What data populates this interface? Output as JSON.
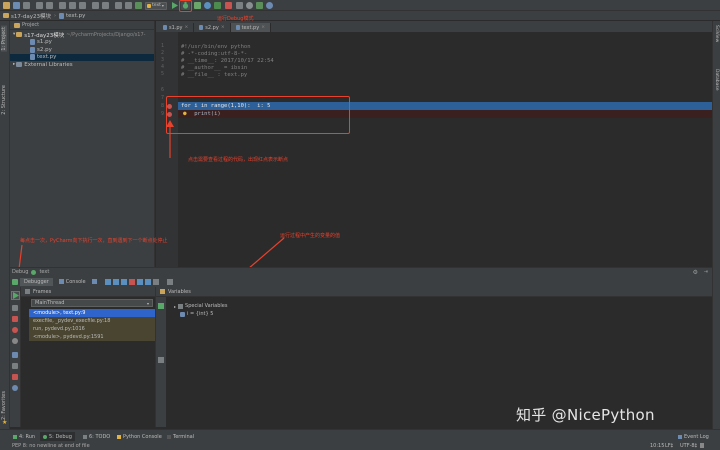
{
  "toolbar": {
    "run_config": "text"
  },
  "navbar": {
    "project": "s17-day23模块",
    "file": "text.py"
  },
  "left_tabs": {
    "project": "1: Project",
    "structure": "2: Structure",
    "favorites": "2: Favorites"
  },
  "right_tabs": {
    "sciview": "SciView",
    "database": "Database"
  },
  "project_panel": {
    "header": "Project",
    "tree": [
      {
        "label": "s17-day23模块",
        "sub": "~/PycharmProjects/Django/s17-"
      },
      {
        "label": "s1.py"
      },
      {
        "label": "s2.py"
      },
      {
        "label": "text.py"
      },
      {
        "label": "External Libraries"
      }
    ]
  },
  "editor": {
    "tabs": [
      "s1.py",
      "s2.py",
      "text.py"
    ],
    "lines": [
      {
        "n": "1",
        "text": "#!/usr/bin/env python"
      },
      {
        "n": "2",
        "text": "# -*-coding:utf-8-*-"
      },
      {
        "n": "3",
        "text": "# __time__: 2017/10/17 22:54"
      },
      {
        "n": "4",
        "text": "# __author__ = ibsin"
      },
      {
        "n": "5",
        "text": "# __file__ : text.py"
      },
      {
        "n": "6",
        "text": ""
      },
      {
        "n": "7",
        "text": ""
      },
      {
        "n": "8",
        "text": "for i in range(1,10):  i: 5"
      },
      {
        "n": "9",
        "text": "    print(i)"
      }
    ]
  },
  "annotations": {
    "debug_mode": "运行Debug模式",
    "breakpoint_tip": "点击需要查看过程的代码，出现红点表示断点",
    "step_tip": "每点击一次，PyCharm向下执行一次，直到遇到下一个断点处停止",
    "vars_tip": "运行过程中产生的变量的值"
  },
  "debug": {
    "title": "Debug",
    "config": "text",
    "tabs": [
      "Debugger",
      "Console"
    ],
    "frames_header": "Frames",
    "thread": "MainThread",
    "frames": [
      "<module>, text.py:9",
      "execfile, _pydev_execfile.py:18",
      "run, pydevd.py:1016",
      "<module>, pydevd.py:1591"
    ],
    "variables_header": "Variables",
    "variables": [
      {
        "label": "Special Variables"
      },
      {
        "label": "i = {int} 5"
      }
    ]
  },
  "statusbar": {
    "tabs": [
      "4: Run",
      "5: Debug",
      "6: TODO",
      "Python Console",
      "Terminal"
    ],
    "event_log": "Event Log",
    "message": "PEP 8: no newline at end of file",
    "position": "10:15",
    "line_sep": "LF‡",
    "encoding": "UTF-8‡"
  },
  "watermark": "知乎 @NicePython",
  "colors": {
    "accent": "#e8412c",
    "exec_line": "#2d6099",
    "breakpoint": "#c75450",
    "frame_sel": "#2f65ca"
  }
}
